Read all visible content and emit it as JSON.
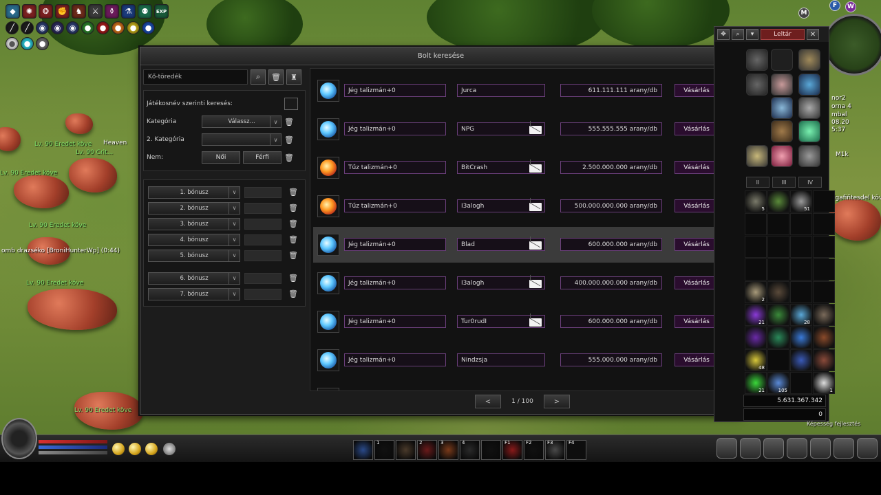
{
  "world": {
    "labels": [
      {
        "text": "Lv. 90 Eredet köve",
        "cls": ""
      },
      {
        "text": "Heaven",
        "cls": "white"
      },
      {
        "text": "Lv. 90 Crit...",
        "cls": ""
      },
      {
        "text": "Lv. 90 Eredet köve",
        "cls": ""
      },
      {
        "text": "Lv. 90 Eredet köve",
        "cls": ""
      },
      {
        "text": "omb drazséko [BroniHunterWp] (0:44)",
        "cls": "white"
      },
      {
        "text": "Lv. 90 Eredet köve",
        "cls": ""
      },
      {
        "text": "Lv. 90 Eredet köve",
        "cls": ""
      }
    ],
    "right_texts": [
      "nor2",
      "orna 4",
      "mbal",
      "08.20",
      "5:37",
      "M1k",
      "Ligafiñtesdel köve"
    ],
    "bottom_right_label": "Képesség fejlesztés"
  },
  "hud": {
    "top_icons": [
      "shield-icon",
      "spiral-icon",
      "wolf-icon",
      "fist-icon",
      "horse-icon",
      "sword-icon",
      "potion-icon",
      "flask-icon",
      "stickman-icon",
      "exp-icon"
    ],
    "exp_label": "EXP",
    "minimap_buttons": [
      "M",
      "F",
      "W"
    ]
  },
  "window": {
    "title": "Bolt keresése",
    "close": "✕"
  },
  "filters": {
    "search_value": "Kő-töredék",
    "player_search_label": "Játékosnév szerinti keresés:",
    "category_label": "Kategória",
    "category_value": "Válassz...",
    "category2_label": "2. Kategória",
    "category2_value": "",
    "gender_label": "Nem:",
    "female": "Női",
    "male": "Férfi",
    "bonuses": [
      "1. bónusz",
      "2. bónusz",
      "3. bónusz",
      "4. bónusz",
      "5. bónusz",
      "6. bónusz",
      "7. bónusz"
    ]
  },
  "results": [
    {
      "gem": "ice",
      "item": "Jég talizmán+0",
      "seller": "Jurca",
      "mail": false,
      "price": "611.111.111 arany/db",
      "buy": "Vásárlás",
      "hl": false
    },
    {
      "gem": "ice",
      "item": "Jég talizmán+0",
      "seller": "NPG",
      "mail": true,
      "price": "555.555.555 arany/db",
      "buy": "Vásárlás",
      "hl": false
    },
    {
      "gem": "fire",
      "item": "Tűz talizmán+0",
      "seller": "BitCrash",
      "mail": true,
      "price": "2.500.000.000 arany/db",
      "buy": "Vásárlás",
      "hl": false
    },
    {
      "gem": "fire",
      "item": "Tűz talizmán+0",
      "seller": "I3alogh",
      "mail": true,
      "price": "500.000.000.000 arany/db",
      "buy": "Vásárlás",
      "hl": false
    },
    {
      "gem": "ice",
      "item": "Jég talizmán+0",
      "seller": "Blad",
      "mail": true,
      "price": "600.000.000 arany/db",
      "buy": "Vásárlás",
      "hl": true
    },
    {
      "gem": "ice",
      "item": "Jég talizmán+0",
      "seller": "I3alogh",
      "mail": true,
      "price": "400.000.000.000 arany/db",
      "buy": "Vásárlás",
      "hl": false
    },
    {
      "gem": "ice",
      "item": "Jég talizmán+0",
      "seller": "Tur0rudI",
      "mail": true,
      "price": "600.000.000 arany/db",
      "buy": "Vásárlás",
      "hl": false
    },
    {
      "gem": "ice",
      "item": "Jég talizmán+0",
      "seller": "Nindzsja",
      "mail": false,
      "price": "555.000.000 arany/db",
      "buy": "Vásárlás",
      "hl": false
    }
  ],
  "pager": {
    "prev": "<",
    "text": "1 / 100",
    "next": ">"
  },
  "inventory": {
    "title": "Leltár",
    "close": "✕",
    "pages": [
      "II",
      "III",
      "IV"
    ],
    "counts": [
      "5",
      "",
      "51",
      "",
      "2",
      "",
      "",
      "",
      "21",
      "",
      "28",
      "",
      "48",
      "",
      "",
      "",
      "21",
      "105",
      "",
      "1"
    ],
    "gold": "5.631.367.342",
    "gem_count": "0"
  },
  "quickbar": {
    "slot_keys": [
      "1",
      "2",
      "3",
      "4",
      "F1",
      "F2",
      "F3",
      "F4"
    ]
  },
  "colors": {
    "accent_purple": "#6a3f7a",
    "inventory_title": "#6e1e1e"
  }
}
